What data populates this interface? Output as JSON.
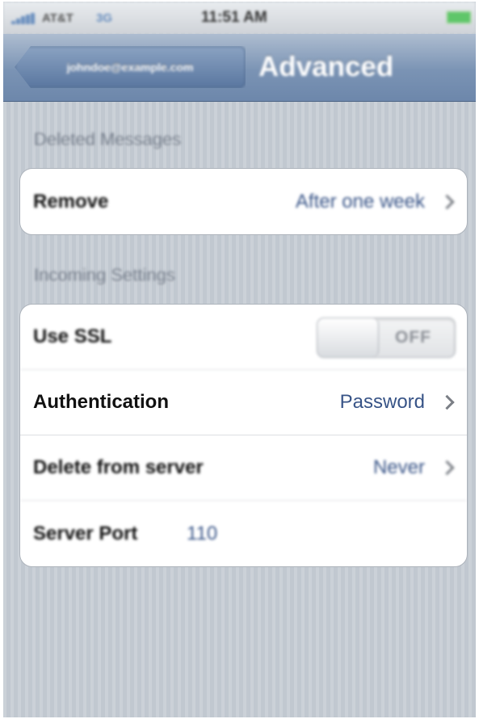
{
  "status_bar": {
    "carrier": "AT&T",
    "network": "3G",
    "time": "11:51 AM"
  },
  "nav": {
    "back_label": "johndoe@example.com",
    "title": "Advanced"
  },
  "sections": {
    "deleted_messages": {
      "header": "Deleted Messages",
      "remove": {
        "label": "Remove",
        "value": "After one week"
      }
    },
    "incoming_settings": {
      "header": "Incoming Settings",
      "use_ssl": {
        "label": "Use SSL",
        "toggle_text": "OFF"
      },
      "authentication": {
        "label": "Authentication",
        "value": "Password"
      },
      "delete_from_server": {
        "label": "Delete from server",
        "value": "Never"
      },
      "server_port": {
        "label": "Server Port",
        "value": "110"
      }
    }
  },
  "colors": {
    "nav_blue": "#6d87ab",
    "value_blue": "#385487",
    "background": "#c5ccd4"
  }
}
